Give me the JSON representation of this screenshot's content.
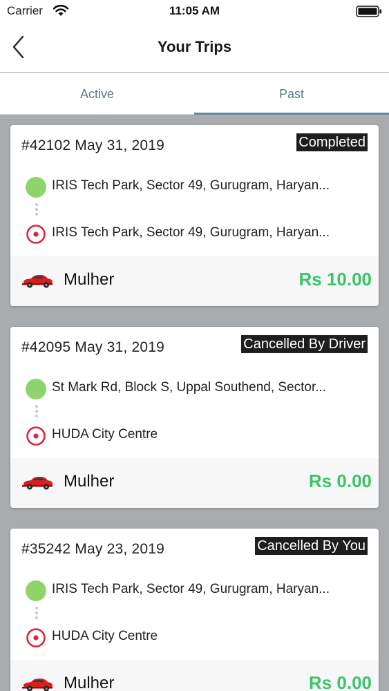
{
  "status_bar": {
    "carrier": "Carrier",
    "time": "11:05 AM"
  },
  "nav": {
    "title": "Your Trips"
  },
  "tabs": [
    {
      "label": "Active",
      "selected": false
    },
    {
      "label": "Past",
      "selected": true
    }
  ],
  "colors": {
    "fare_green": "#3cc46a",
    "pickup_dot": "#8fd46a",
    "drop_red": "#e0243b",
    "tab_indicator": "#5d8aa0"
  },
  "trips": [
    {
      "header": "#42102 May 31, 2019",
      "status": "Completed",
      "pickup": "IRIS Tech Park, Sector 49, Gurugram, Haryan...",
      "drop": "IRIS Tech Park, Sector 49, Gurugram, Haryan...",
      "driver": "Mulher",
      "fare": "Rs 10.00"
    },
    {
      "header": "#42095 May 31, 2019",
      "status": "Cancelled By Driver",
      "pickup": "St Mark Rd, Block S, Uppal Southend, Sector...",
      "drop": "HUDA City Centre",
      "driver": "Mulher",
      "fare": "Rs 0.00"
    },
    {
      "header": "#35242 May 23, 2019",
      "status": "Cancelled By You",
      "pickup": "IRIS Tech Park, Sector 49, Gurugram, Haryan...",
      "drop": "HUDA City Centre",
      "driver": "Mulher",
      "fare": "Rs 0.00"
    }
  ]
}
